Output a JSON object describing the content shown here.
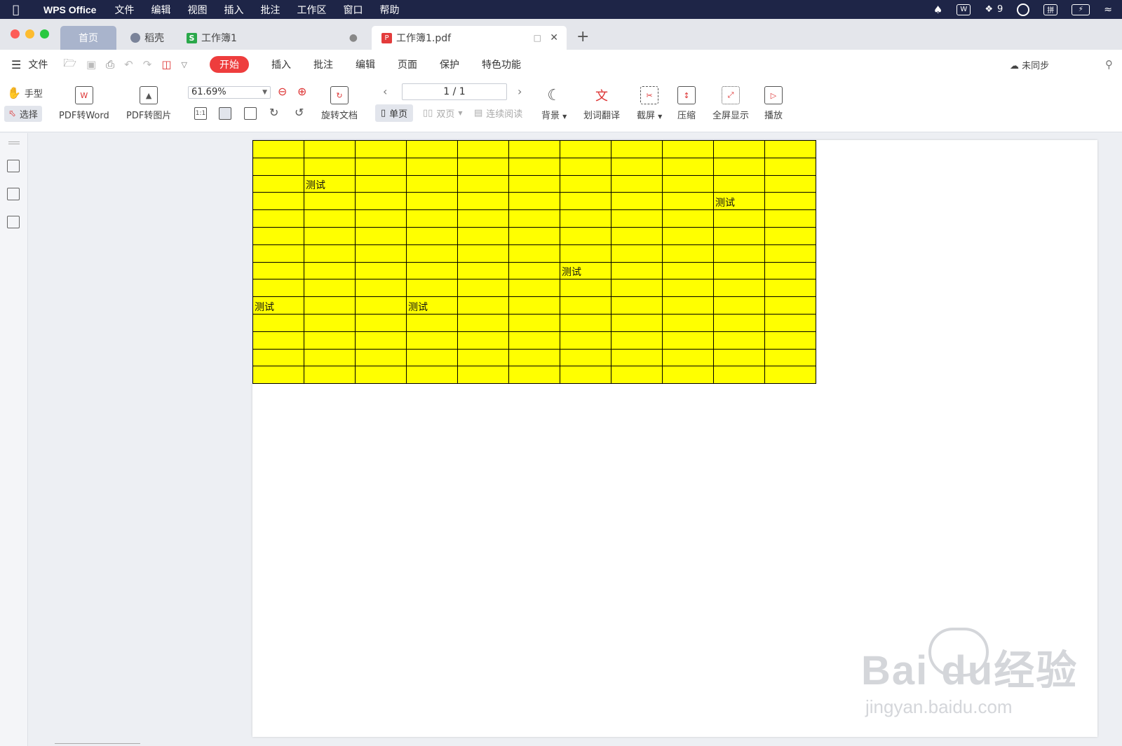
{
  "menubar": {
    "app_name": "WPS Office",
    "items": [
      "文件",
      "编辑",
      "视图",
      "插入",
      "批注",
      "工作区",
      "窗口",
      "帮助"
    ],
    "wechat_count": "9"
  },
  "tabs": {
    "home": "首页",
    "daoke": "稻壳",
    "workbook": "工作簿1",
    "pdf": "工作簿1.pdf",
    "add": "+"
  },
  "ribbon": {
    "file": "文件",
    "tabs": [
      "开始",
      "插入",
      "批注",
      "编辑",
      "页面",
      "保护",
      "特色功能"
    ],
    "active_tab": "开始",
    "sync_status": "未同步"
  },
  "toolbar": {
    "hand": "手型",
    "select": "选择",
    "pdf_to_word": "PDF转Word",
    "pdf_to_image": "PDF转图片",
    "zoom": "61.69%",
    "rotate_doc": "旋转文档",
    "page_indicator": "1 / 1",
    "single_page": "单页",
    "double_page": "双页",
    "continuous": "连续阅读",
    "background": "背景",
    "translate": "划词翻译",
    "screenshot": "截屏",
    "compress": "压缩",
    "fullscreen": "全屏显示",
    "play": "播放"
  },
  "sheet": {
    "rows": 14,
    "cols": 11,
    "fill_color": "#ffff00",
    "cells": [
      {
        "row": 2,
        "col": 1,
        "text": "测试"
      },
      {
        "row": 3,
        "col": 9,
        "text": "测试"
      },
      {
        "row": 7,
        "col": 6,
        "text": "测试"
      },
      {
        "row": 9,
        "col": 0,
        "text": "测试"
      },
      {
        "row": 9,
        "col": 3,
        "text": "测试"
      }
    ]
  },
  "watermark": {
    "brand": "Bai du经验",
    "url": "jingyan.baidu.com"
  }
}
